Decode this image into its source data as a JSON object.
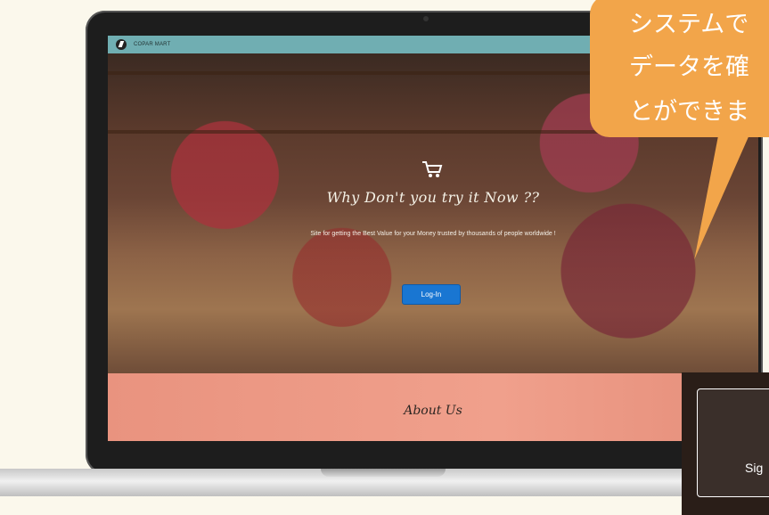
{
  "app": {
    "brand": "COPAR MART"
  },
  "hero": {
    "title": "Why Don't you try it Now ??",
    "subtitle": "Site for getting the Best Value for your Money trusted by thousands of people worldwide !",
    "login_label": "Log-In"
  },
  "about": {
    "title": "About Us"
  },
  "callout": {
    "lines": [
      "システムで",
      "データを確",
      "とができま"
    ]
  },
  "popup": {
    "text": "Sig"
  },
  "colors": {
    "accent": "#1976d2",
    "callout": "#f2a54a",
    "about_bg": "#f0a08c",
    "navbar": "#78bec3"
  },
  "icons": {
    "brand": "brand-logo-icon",
    "cart": "shopping-cart-icon"
  }
}
